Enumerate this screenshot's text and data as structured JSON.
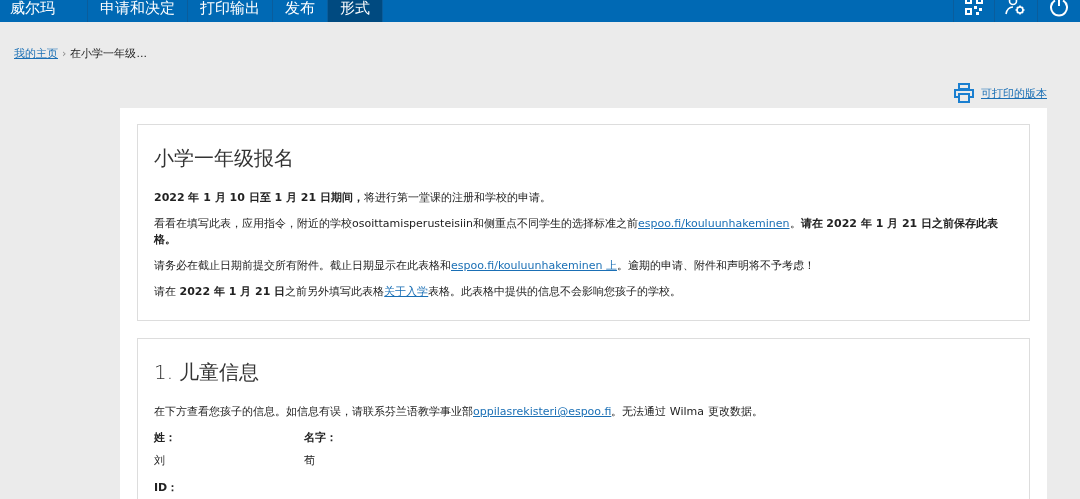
{
  "nav": {
    "brand": "威尔玛",
    "tabs": [
      {
        "label": "申请和决定",
        "selected": false
      },
      {
        "label": "打印输出",
        "selected": false
      },
      {
        "label": "发布",
        "selected": false
      },
      {
        "label": "形式",
        "selected": true
      }
    ]
  },
  "breadcrumb": {
    "links": [
      "我的主页"
    ],
    "separator": "›",
    "current": "在小学一年级..."
  },
  "print_link": "可打印的版本",
  "sections": [
    {
      "title": "小学一年级报名",
      "paragraphs": [
        [
          {
            "kind": "text",
            "text": "**2022 年 1 月 10 日至 1 月 21 日期间，**将进行第一堂课的注册和学校的申请。"
          }
        ],
        [
          {
            "kind": "text",
            "text": "看看在填写此表，应用指令，附近的学校osoittamisperusteisiin和侧重点不同学生的选择标准之前"
          },
          {
            "kind": "link",
            "text": "espoo.fi/kouluunhakeminen"
          },
          {
            "kind": "text",
            "text": "。**请在 2022 年 1 月 21 日之前保存此表格。**"
          }
        ],
        [
          {
            "kind": "text",
            "text": "请务必在截止日期前提交所有附件。截止日期显示在此表格和"
          },
          {
            "kind": "link",
            "text": "espoo.fi/kouluunhakeminen 上"
          },
          {
            "kind": "text",
            "text": "。逾期的申请、附件和声明将不予考虑！"
          }
        ],
        [
          {
            "kind": "text",
            "text": "请在 **2022 年 1 月 21 日**之前另外填写此表格"
          },
          {
            "kind": "link",
            "text": "关于入学"
          },
          {
            "kind": "text",
            "text": "表格。此表格中提供的信息不会影响您孩子的学校。"
          }
        ]
      ]
    },
    {
      "title": "1. 儿童信息",
      "paragraphs": [
        [
          {
            "kind": "text",
            "text": "在下方查看您孩子的信息。如信息有误，请联系芬兰语教学事业部"
          },
          {
            "kind": "link",
            "text": "oppilasrekisteri@espoo.fi"
          },
          {
            "kind": "text",
            "text": "。无法通过 Wilma 更改数据。"
          }
        ]
      ],
      "fields": [
        {
          "label": "姓：",
          "value": "刘"
        },
        {
          "label": "名字：",
          "value": "荀"
        },
        {
          "label": "ID："
        }
      ]
    }
  ]
}
